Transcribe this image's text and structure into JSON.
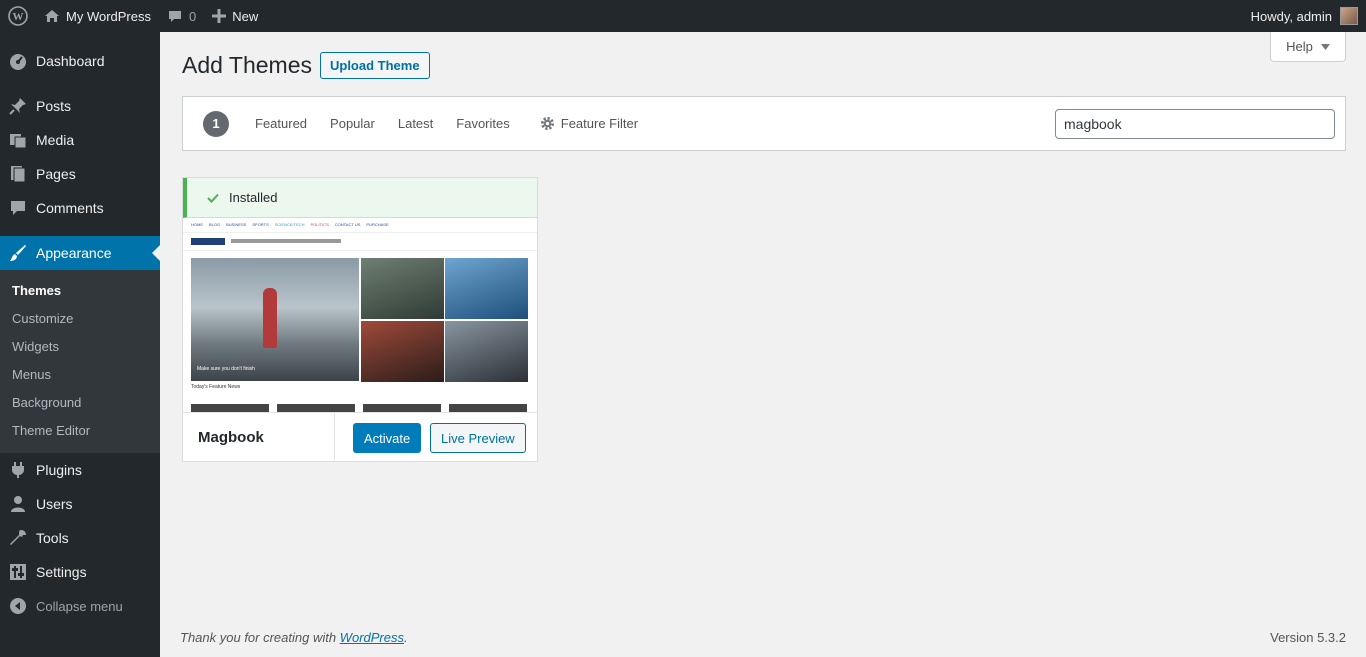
{
  "adminbar": {
    "site_name": "My WordPress",
    "comments_count": "0",
    "new_label": "New",
    "greeting": "Howdy, admin"
  },
  "sidebar": {
    "items": [
      {
        "label": "Dashboard",
        "icon": "dashboard-icon"
      },
      {
        "label": "Posts",
        "icon": "pin-icon"
      },
      {
        "label": "Media",
        "icon": "media-icon"
      },
      {
        "label": "Pages",
        "icon": "pages-icon"
      },
      {
        "label": "Comments",
        "icon": "comment-icon"
      },
      {
        "label": "Appearance",
        "icon": "brush-icon"
      },
      {
        "label": "Plugins",
        "icon": "plugin-icon"
      },
      {
        "label": "Users",
        "icon": "user-icon"
      },
      {
        "label": "Tools",
        "icon": "wrench-icon"
      },
      {
        "label": "Settings",
        "icon": "settings-icon"
      },
      {
        "label": "Collapse menu",
        "icon": "collapse-icon"
      }
    ],
    "appearance_sub": [
      "Themes",
      "Customize",
      "Widgets",
      "Menus",
      "Background",
      "Theme Editor"
    ]
  },
  "header": {
    "help_label": "Help",
    "title": "Add Themes",
    "upload_label": "Upload Theme"
  },
  "filter": {
    "count": "1",
    "links": [
      "Featured",
      "Popular",
      "Latest",
      "Favorites"
    ],
    "feature_filter": "Feature Filter",
    "search_value": "magbook"
  },
  "theme": {
    "installed_label": "Installed",
    "name": "Magbook",
    "activate_label": "Activate",
    "preview_label": "Live Preview",
    "screenshot": {
      "nav": [
        "HOME",
        "BLOG",
        "BUSINESS",
        "SPORTS",
        "SCIENCE/TECH",
        "POLITICS",
        "CONTACT US",
        "PURCHASE"
      ],
      "big_caption": "Make sure you don't finish",
      "section_title": "Today's Feature News"
    }
  },
  "footer": {
    "thanks_prefix": "Thank you for creating with ",
    "thanks_link": "WordPress",
    "thanks_suffix": ".",
    "version": "Version 5.3.2"
  },
  "colors": {
    "accent": "#0073aa",
    "sidebar_bg": "#23282d",
    "installed_green": "#46b450"
  }
}
